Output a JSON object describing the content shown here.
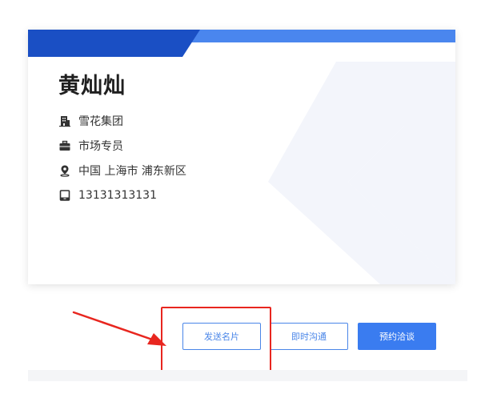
{
  "card": {
    "name": "黄灿灿",
    "company": "雪花集团",
    "position": "市场专员",
    "location": "中国 上海市 浦东新区",
    "phone": "13131313131"
  },
  "actions": {
    "send_card_label": "发送名片",
    "instant_chat_label": "即时沟通",
    "appointment_label": "预约洽谈"
  },
  "icons": {
    "company": "building-icon",
    "position": "briefcase-icon",
    "location": "location-pin-icon",
    "phone": "phone-icon"
  },
  "colors": {
    "header_dark_blue": "#1a4fc4",
    "header_light_blue": "#4a86ee",
    "button_blue": "#3a7cf0",
    "annotation_red": "#e8261f"
  }
}
